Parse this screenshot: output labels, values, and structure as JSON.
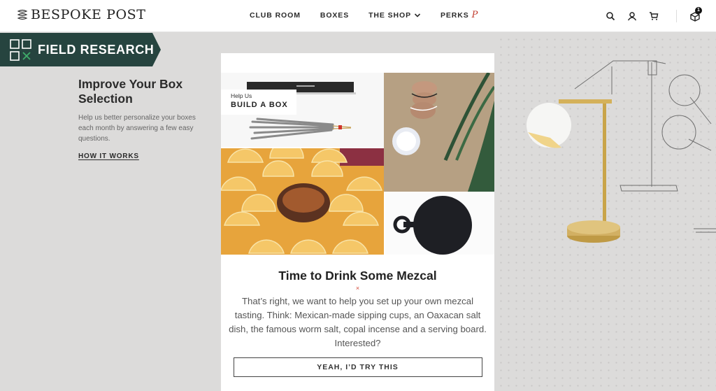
{
  "header": {
    "brand": "BESPOKE POST",
    "nav": [
      {
        "label": "CLUB ROOM"
      },
      {
        "label": "BOXES"
      },
      {
        "label": "THE SHOP",
        "has_dropdown": true
      },
      {
        "label": "PERKS",
        "badge_glyph": "P"
      }
    ],
    "icons": [
      "search-icon",
      "user-icon",
      "cart-icon",
      "box-icon"
    ],
    "box_count": "1"
  },
  "banner": {
    "title": "FIELD RESEARCH",
    "color": "#26443f",
    "accent": "#3fae6a"
  },
  "intro": {
    "heading": "Improve Your Box Selection",
    "description": "Help us better personalize your boxes each month by answering a few easy questions.",
    "link": "HOW IT WORKS"
  },
  "card": {
    "overlay_small": "Help Us",
    "overlay_big": "BUILD A BOX",
    "images": [
      "copal-incense",
      "mezcal-sipping-cups",
      "orange-slices-worm-salt",
      "serving-board"
    ],
    "title": "Time to Drink Some Mezcal",
    "divider_glyph": "×",
    "description": "That’s right, we want to help you set up your own mezcal tasting. Think: Mexican-made sipping cups, an Oaxacan salt dish, the famous worm salt, copal incense and a serving board. Interested?",
    "cta": "YEAH, I’D TRY THIS"
  },
  "decor": {
    "image": "brass-desk-lamp-with-sketch"
  }
}
